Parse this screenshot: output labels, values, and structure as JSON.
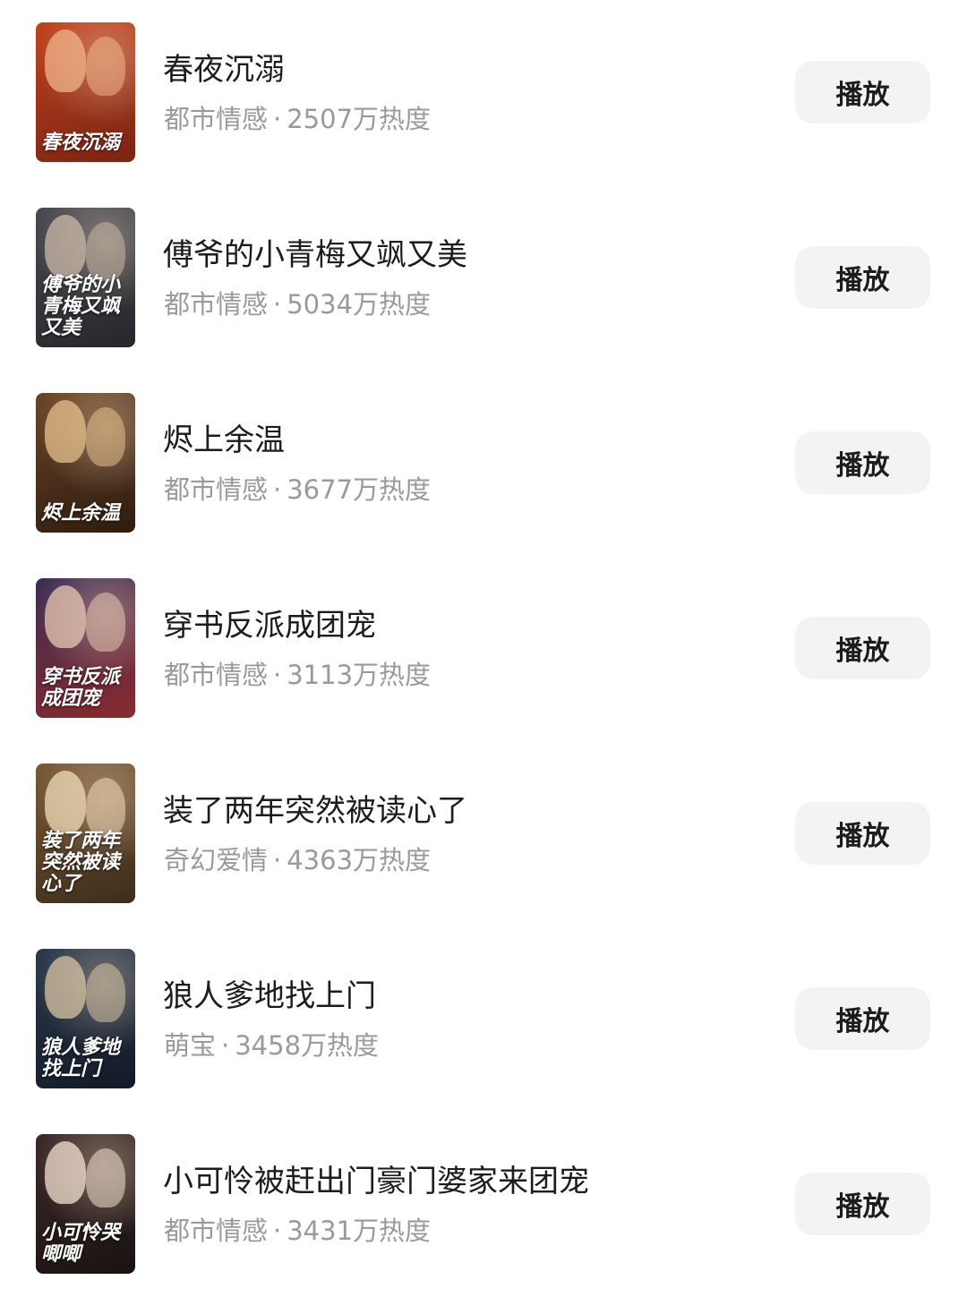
{
  "items": [
    {
      "title": "春夜沉溺",
      "genre": "都市情感",
      "separator": "·",
      "heat": "2507万热度",
      "play_label": "播放",
      "cover_text": "春夜沉溺",
      "cover_colors": [
        "#c0431e",
        "#7a2414",
        "#f0b48a"
      ]
    },
    {
      "title": "傅爷的小青梅又飒又美",
      "genre": "都市情感",
      "separator": "·",
      "heat": "5034万热度",
      "play_label": "播放",
      "cover_text": "傅爷的小青梅又飒又美",
      "cover_colors": [
        "#4a4a52",
        "#26262c",
        "#c9b8a8"
      ]
    },
    {
      "title": "烬上余温",
      "genre": "都市情感",
      "separator": "·",
      "heat": "3677万热度",
      "play_label": "播放",
      "cover_text": "烬上余温",
      "cover_colors": [
        "#6b4426",
        "#2e1c10",
        "#e6c08c"
      ]
    },
    {
      "title": "穿书反派成团宠",
      "genre": "都市情感",
      "separator": "·",
      "heat": "3113万热度",
      "play_label": "播放",
      "cover_text": "穿书反派成团宠",
      "cover_colors": [
        "#3a2d52",
        "#8a2a2e",
        "#e8c9b4"
      ]
    },
    {
      "title": "装了两年突然被读心了",
      "genre": "奇幻爱情",
      "separator": "·",
      "heat": "4363万热度",
      "play_label": "播放",
      "cover_text": "装了两年突然被读心了",
      "cover_colors": [
        "#7a5a36",
        "#3e2c1c",
        "#f2dcb8"
      ]
    },
    {
      "title": "狼人爹地找上门",
      "genre": "萌宝",
      "separator": "·",
      "heat": "3458万热度",
      "play_label": "播放",
      "cover_text": "狼人爹地找上门",
      "cover_colors": [
        "#2c3a4e",
        "#121a26",
        "#d8c4a4"
      ]
    },
    {
      "title": "小可怜被赶出门豪门婆家来团宠",
      "genre": "都市情感",
      "separator": "·",
      "heat": "3431万热度",
      "play_label": "播放",
      "cover_text": "小可怜哭唧唧",
      "cover_colors": [
        "#3e2a2a",
        "#1a1212",
        "#f4e2d2"
      ]
    }
  ]
}
